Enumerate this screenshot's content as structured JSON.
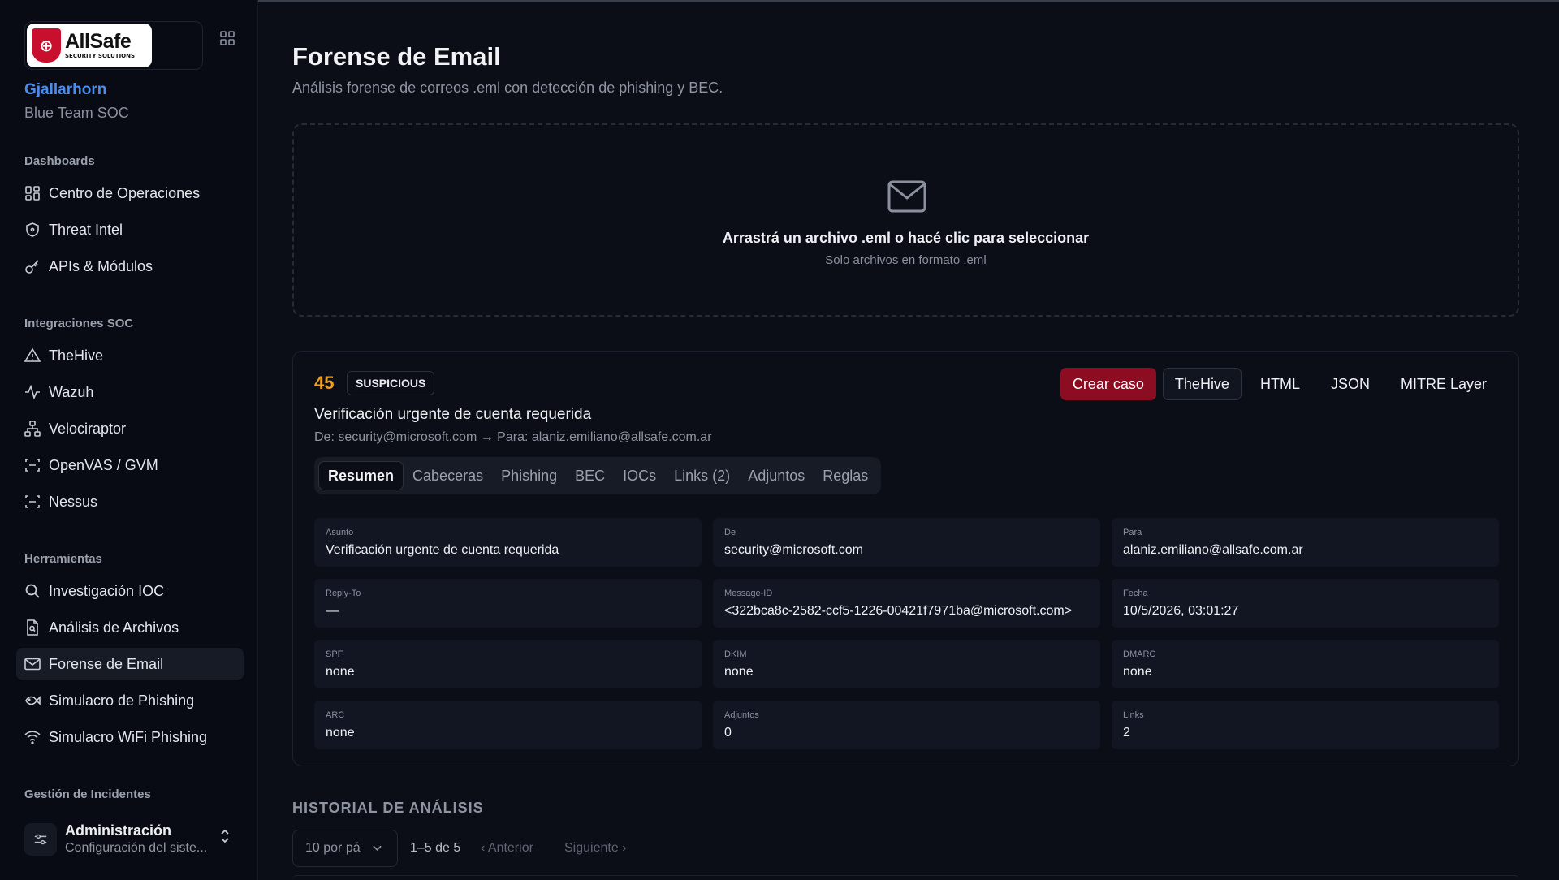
{
  "brand": {
    "logo_name": "AllSafe",
    "logo_sub": "SECURITY SOLUTIONS",
    "org_name": "Gjallarhorn",
    "team": "Blue Team SOC"
  },
  "sidebar": {
    "sections": [
      {
        "title": "Dashboards",
        "items": [
          {
            "label": "Centro de Operaciones",
            "icon": "dashboard-icon"
          },
          {
            "label": "Threat Intel",
            "icon": "shield-icon"
          },
          {
            "label": "APIs & Módulos",
            "icon": "key-icon"
          }
        ]
      },
      {
        "title": "Integraciones SOC",
        "items": [
          {
            "label": "TheHive",
            "icon": "warning-triangle-icon"
          },
          {
            "label": "Wazuh",
            "icon": "activity-icon"
          },
          {
            "label": "Velociraptor",
            "icon": "network-icon"
          },
          {
            "label": "OpenVAS / GVM",
            "icon": "scan-icon"
          },
          {
            "label": "Nessus",
            "icon": "scan-icon"
          }
        ]
      },
      {
        "title": "Herramientas",
        "items": [
          {
            "label": "Investigación IOC",
            "icon": "search-icon"
          },
          {
            "label": "Análisis de Archivos",
            "icon": "file-search-icon"
          },
          {
            "label": "Forense de Email",
            "icon": "mail-icon",
            "active": true
          },
          {
            "label": "Simulacro de Phishing",
            "icon": "fish-icon"
          },
          {
            "label": "Simulacro WiFi Phishing",
            "icon": "wifi-icon"
          }
        ]
      },
      {
        "title": "Gestión de Incidentes",
        "items": []
      }
    ],
    "admin": {
      "title": "Administración",
      "subtitle": "Configuración del siste..."
    }
  },
  "page": {
    "title": "Forense de Email",
    "subtitle": "Análisis forense de correos .eml con detección de phishing y BEC."
  },
  "dropzone": {
    "icon": "mail-icon",
    "title": "Arrastrá un archivo .eml o hacé clic para seleccionar",
    "hint": "Solo archivos en formato .eml"
  },
  "result": {
    "score": "45",
    "verdict": "SUSPICIOUS",
    "score_color": "#f0a020",
    "subject": "Verificación urgente de cuenta requerida",
    "from_to": "De: security@microsoft.com → Para: alaniz.emiliano@allsafe.com.ar",
    "actions": [
      {
        "label": "Crear caso",
        "style": "primary"
      },
      {
        "label": "TheHive",
        "style": "outline"
      },
      {
        "label": "HTML",
        "style": "ghost"
      },
      {
        "label": "JSON",
        "style": "ghost"
      },
      {
        "label": "MITRE Layer",
        "style": "ghost"
      }
    ],
    "tabs": [
      "Resumen",
      "Cabeceras",
      "Phishing",
      "BEC",
      "IOCs",
      "Links (2)",
      "Adjuntos",
      "Reglas"
    ],
    "active_tab": "Resumen",
    "fields": [
      {
        "label": "Asunto",
        "value": "Verificación urgente de cuenta requerida"
      },
      {
        "label": "De",
        "value": "security@microsoft.com"
      },
      {
        "label": "Para",
        "value": "alaniz.emiliano@allsafe.com.ar"
      },
      {
        "label": "Reply-To",
        "value": "—"
      },
      {
        "label": "Message-ID",
        "value": "<322bca8c-2582-ccf5-1226-00421f7971ba@microsoft.com>"
      },
      {
        "label": "Fecha",
        "value": "10/5/2026, 03:01:27"
      },
      {
        "label": "SPF",
        "value": "none"
      },
      {
        "label": "DKIM",
        "value": "none"
      },
      {
        "label": "DMARC",
        "value": "none"
      },
      {
        "label": "ARC",
        "value": "none"
      },
      {
        "label": "Adjuntos",
        "value": "0"
      },
      {
        "label": "Links",
        "value": "2"
      }
    ]
  },
  "history": {
    "title": "HISTORIAL DE ANÁLISIS",
    "page_size": "10 por pá",
    "range": "1–5 de 5",
    "prev": "‹ Anterior",
    "next": "Siguiente ›"
  }
}
